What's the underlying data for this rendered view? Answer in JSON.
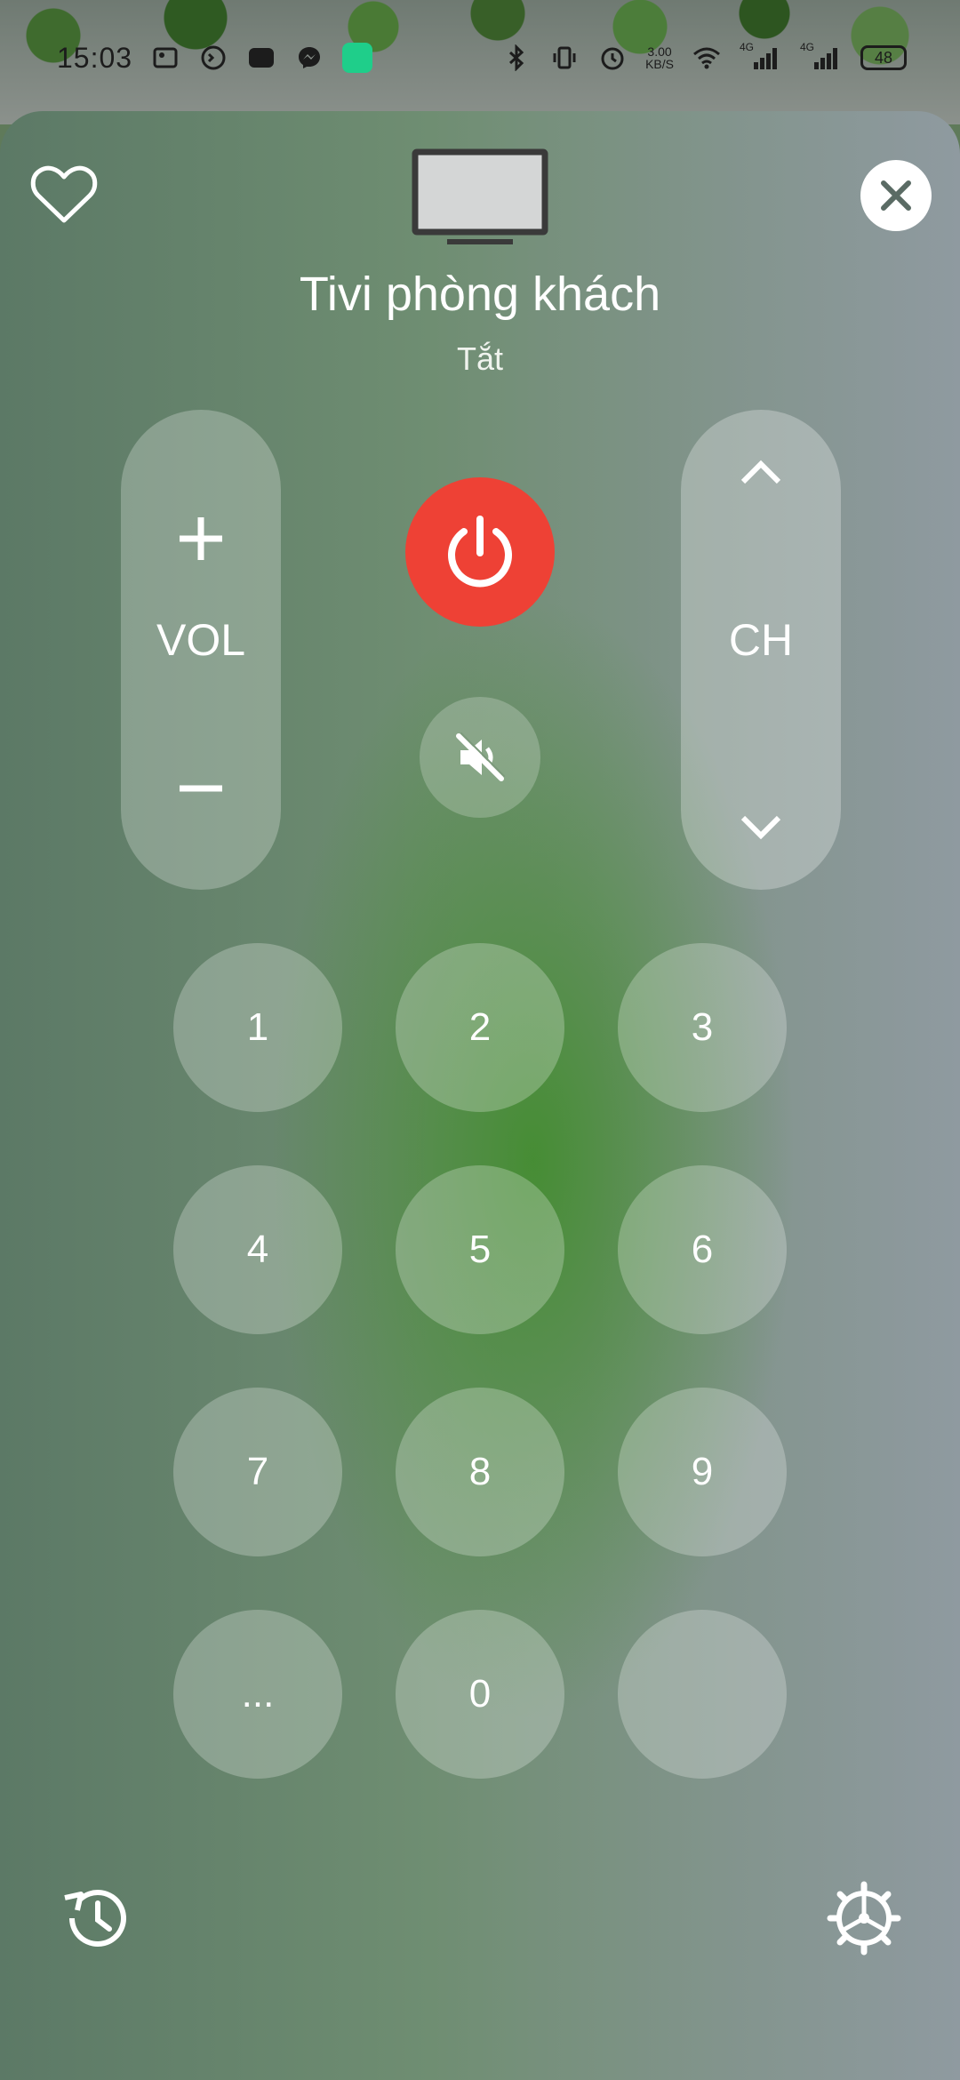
{
  "status_bar": {
    "time": "15:03",
    "net_speed_value": "3.00",
    "net_speed_unit": "KB/S",
    "signal_1": "4G",
    "signal_2": "4G",
    "battery": "48"
  },
  "remote": {
    "device_name": "Tivi phòng khách",
    "device_status": "Tắt",
    "power_color": "#ee4135",
    "volume": {
      "label": "VOL",
      "up_icon": "plus-icon",
      "down_icon": "minus-icon"
    },
    "channel": {
      "label": "CH",
      "up_icon": "chevron-up-icon",
      "down_icon": "chevron-down-icon"
    },
    "keys": [
      "1",
      "2",
      "3",
      "4",
      "5",
      "6",
      "7",
      "8",
      "9",
      "...",
      "0",
      ""
    ]
  },
  "icons": {
    "favorite": "heart-outline-icon",
    "close": "close-icon",
    "device": "tv-icon",
    "power": "power-icon",
    "mute": "volume-off-icon",
    "history": "history-icon",
    "settings": "settings-gear-icon"
  }
}
